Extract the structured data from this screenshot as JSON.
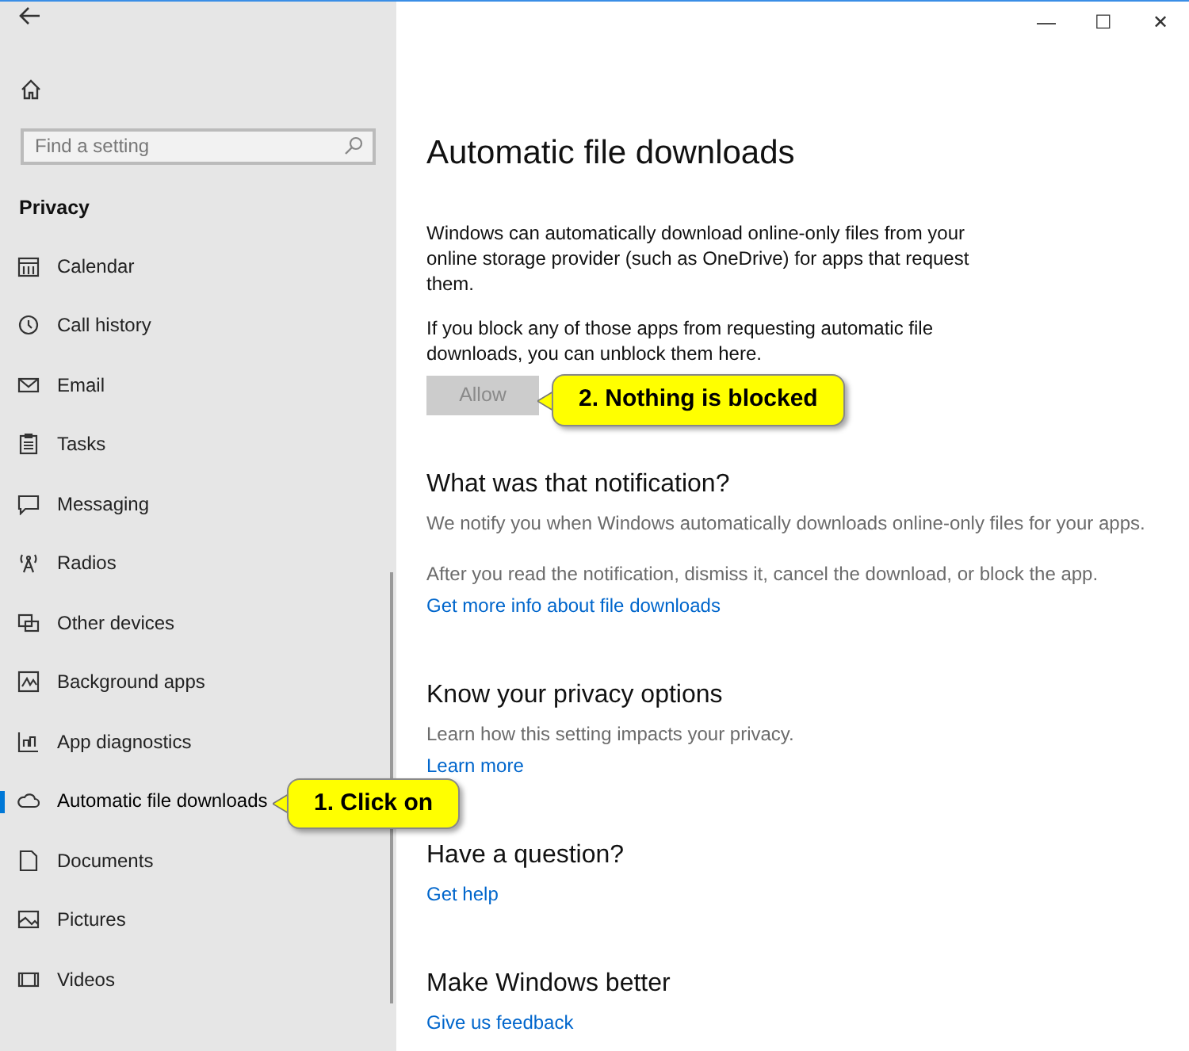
{
  "window": {
    "controls": [
      "—",
      "☐",
      "✕"
    ]
  },
  "sidebar": {
    "search": {
      "placeholder": "Find a setting"
    },
    "section": "Privacy",
    "items": [
      {
        "label": "Calendar",
        "selected": false
      },
      {
        "label": "Call history",
        "selected": false
      },
      {
        "label": "Email",
        "selected": false
      },
      {
        "label": "Tasks",
        "selected": false
      },
      {
        "label": "Messaging",
        "selected": false
      },
      {
        "label": "Radios",
        "selected": false
      },
      {
        "label": "Other devices",
        "selected": false
      },
      {
        "label": "Background apps",
        "selected": false
      },
      {
        "label": "App diagnostics",
        "selected": false
      },
      {
        "label": "Automatic file downloads",
        "selected": true
      },
      {
        "label": "Documents",
        "selected": false
      },
      {
        "label": "Pictures",
        "selected": false
      },
      {
        "label": "Videos",
        "selected": false
      }
    ]
  },
  "page": {
    "title": "Automatic file downloads",
    "intro": [
      "Windows can automatically download online-only files from your online storage provider (such as OneDrive) for apps that request them.",
      "If you block any of those apps from requesting automatic file downloads, you can unblock them here."
    ],
    "allow_button": {
      "label": "Allow",
      "disabled": true
    },
    "sections": [
      {
        "heading": "What was that notification?",
        "paragraphs": [
          "We notify you when Windows automatically downloads online-only files for your apps.",
          "After you read the notification, dismiss it, cancel the download, or block the app."
        ],
        "link": "Get more info about file downloads"
      },
      {
        "heading": "Know your privacy options",
        "paragraphs": [
          "Learn how this setting impacts your privacy."
        ],
        "link": "Learn more"
      },
      {
        "heading": "Have a question?",
        "link": "Get help"
      },
      {
        "heading": "Make Windows better",
        "link": "Give us feedback"
      }
    ]
  },
  "callouts": [
    {
      "text": "1. Click on"
    },
    {
      "text": "2. Nothing is blocked"
    }
  ]
}
